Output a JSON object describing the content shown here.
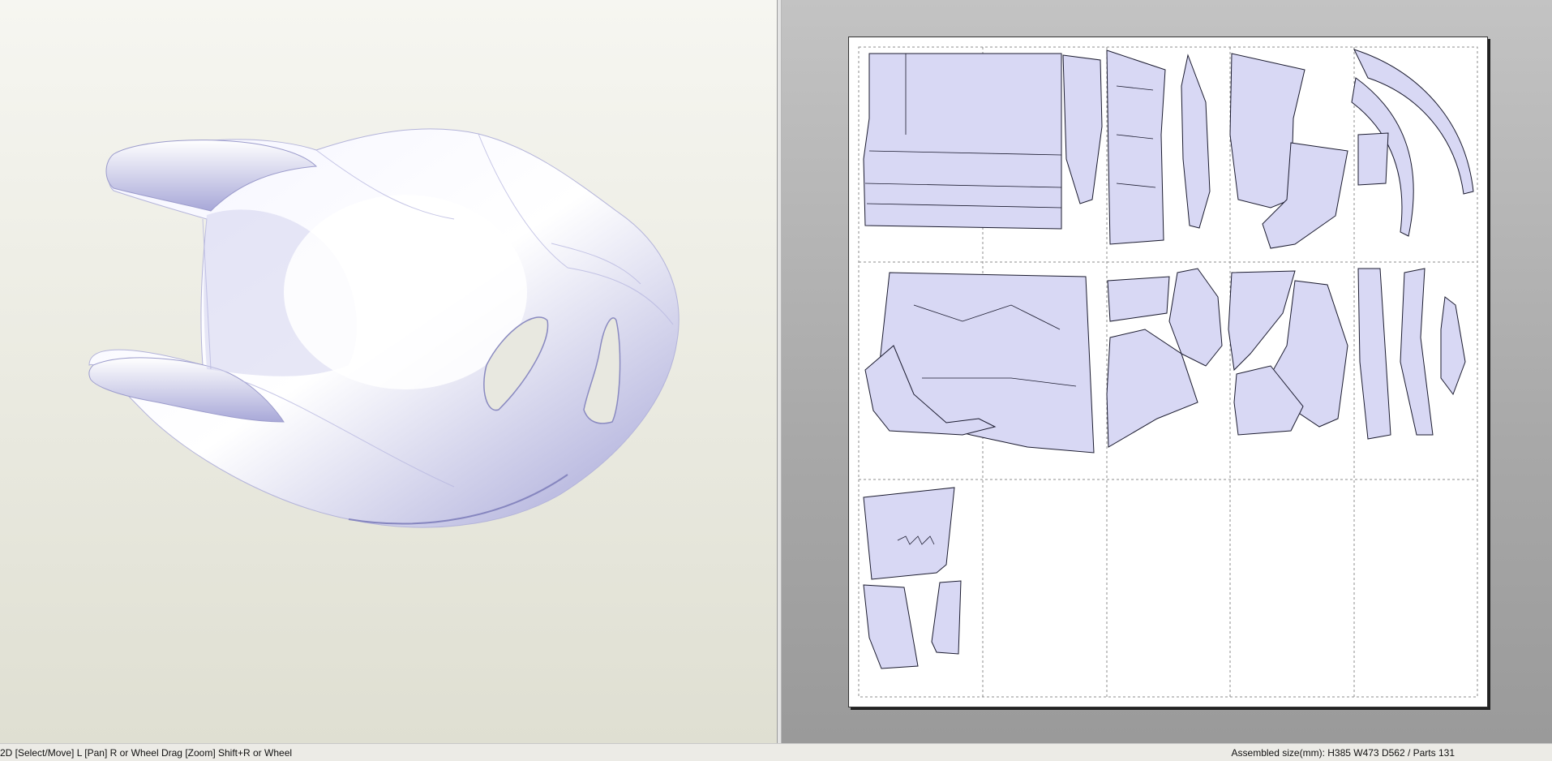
{
  "status": {
    "left": "2D [Select/Move] L [Pan] R or Wheel Drag [Zoom] Shift+R or Wheel",
    "right": "Assembled size(mm): H385 W473 D562 / Parts 131"
  },
  "colors": {
    "part_fill": "#d8d8f4",
    "model_light": "#ffffff",
    "model_shadow": "#9a9ad0"
  },
  "icons": {
    "model": "mask-model-icon",
    "parts": "unfolded-part-icon"
  }
}
